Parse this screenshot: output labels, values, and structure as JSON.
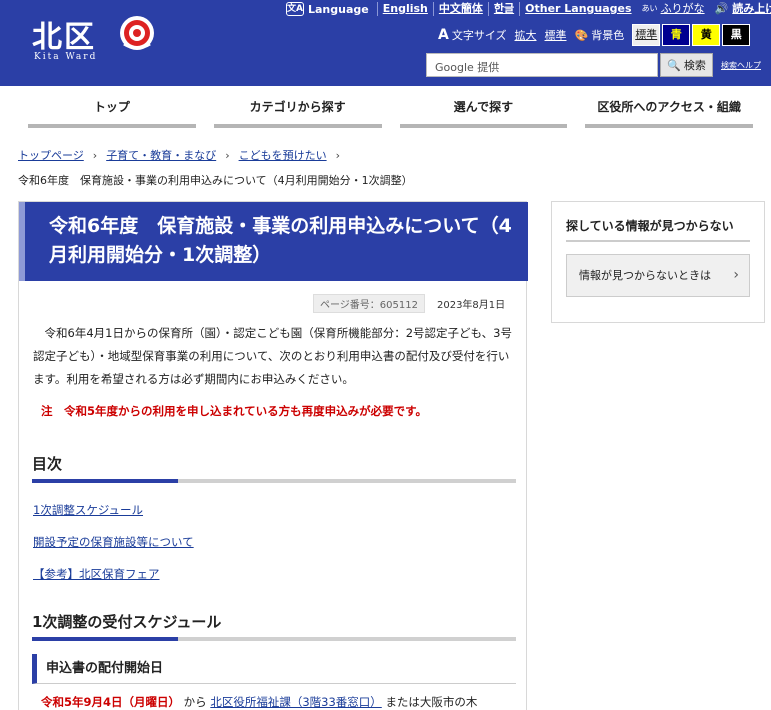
{
  "header": {
    "logo_text": "北区",
    "logo_sub": "Kita Ward",
    "lang": [
      "Language",
      "English",
      "中文簡体",
      "한글",
      "Other Languages"
    ],
    "furigana_ruby": "あい",
    "furigana": "ふりがな",
    "read_aloud": "読み上げ",
    "font_size_label": "文字サイズ",
    "font_enlarge": "拡大",
    "font_standard": "標準",
    "bg_label": "背景色",
    "bg_options": [
      "標準",
      "青",
      "黄",
      "黒"
    ],
    "search_placeholder": "Google 提供",
    "search_button": "検索",
    "search_help": "検索ヘルプ"
  },
  "colors": {
    "brand": "#2b3fa6",
    "notice": "#cc0000",
    "link": "#1a3c99",
    "bg_yellow": "#ffff00",
    "bg_black": "#000000"
  },
  "nav": [
    "トップ",
    "カテゴリから探す",
    "選んで探す",
    "区役所へのアクセス・組織"
  ],
  "breadcrumb": [
    "トップページ",
    "子育て・教育・まなび",
    "こどもを預けたい"
  ],
  "breadcrumb_current": "令和6年度　保育施設・事業の利用申込みについて（4月利用開始分・1次調整）",
  "article": {
    "title": "令和6年度　保育施設・事業の利用申込みについて（4月利用開始分・1次調整）",
    "page_number": "ページ番号：605112",
    "date": "2023年8月1日",
    "intro": "令和6年4月1日からの保育所（園）・認定こども園（保育所機能部分：2号認定子ども、3号認定子ども）・地域型保育事業の利用について、次のとおり利用申込書の配付及び受付を行います。利用を希望される方は必ず期間内にお申込みください。",
    "notice": "注　令和5年度からの利用を申し込まれている方も再度申込みが必要です。",
    "toc_heading": "目次",
    "toc": [
      "1次調整スケジュール",
      "開設予定の保育施設等について",
      "【参考】北区保育フェア"
    ],
    "schedule_heading": "1次調整の受付スケジュール",
    "sub_heading": "申込書の配付開始日",
    "schedule_date": "令和5年9月4日（月曜日）",
    "schedule_from": "から",
    "schedule_link": "北区役所福祉課（3階33番窓口）",
    "schedule_rest": "または大阪市の木"
  },
  "sidebar": {
    "title": "探している情報が見つからない",
    "button": "情報が見つからないときは"
  }
}
